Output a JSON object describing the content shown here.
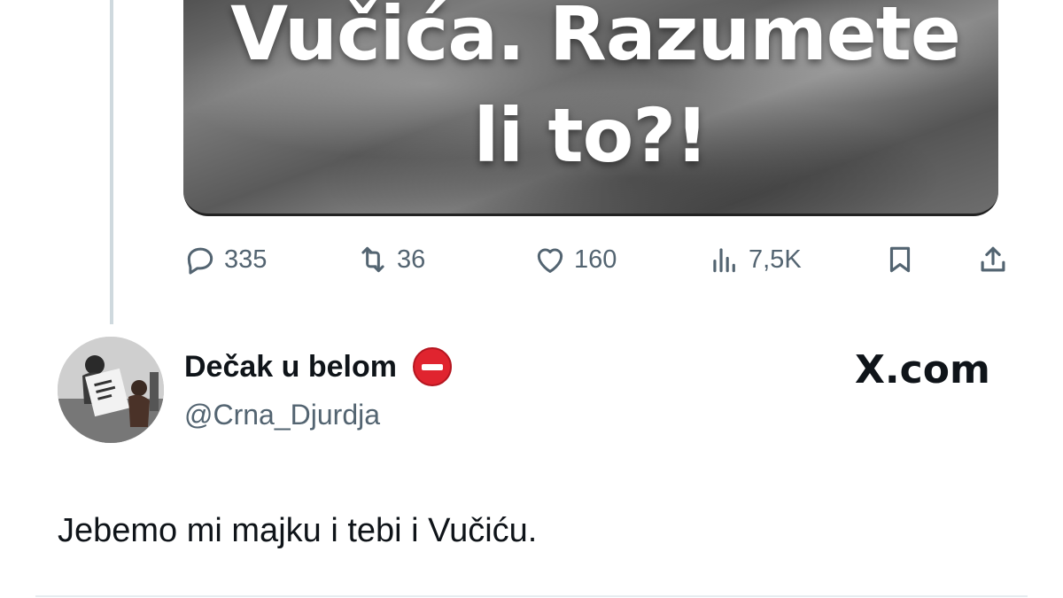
{
  "quoted_media": {
    "line1": "Vučića. Razumete",
    "line2": "li to?!"
  },
  "actions": {
    "replies": "335",
    "retweets": "36",
    "likes": "160",
    "views": "7,5K"
  },
  "author": {
    "display_name": "Dečak u belom",
    "badge_icon": "no-entry-emoji",
    "handle": "@Crna_Djurdja"
  },
  "brand": "X.com",
  "tweet_text": "Jebemo mi majku i tebi i Vučiću.",
  "colors": {
    "muted": "#536471",
    "text": "#0f1419",
    "thread_line": "#cfd9de",
    "badge_red": "#e0242f"
  }
}
